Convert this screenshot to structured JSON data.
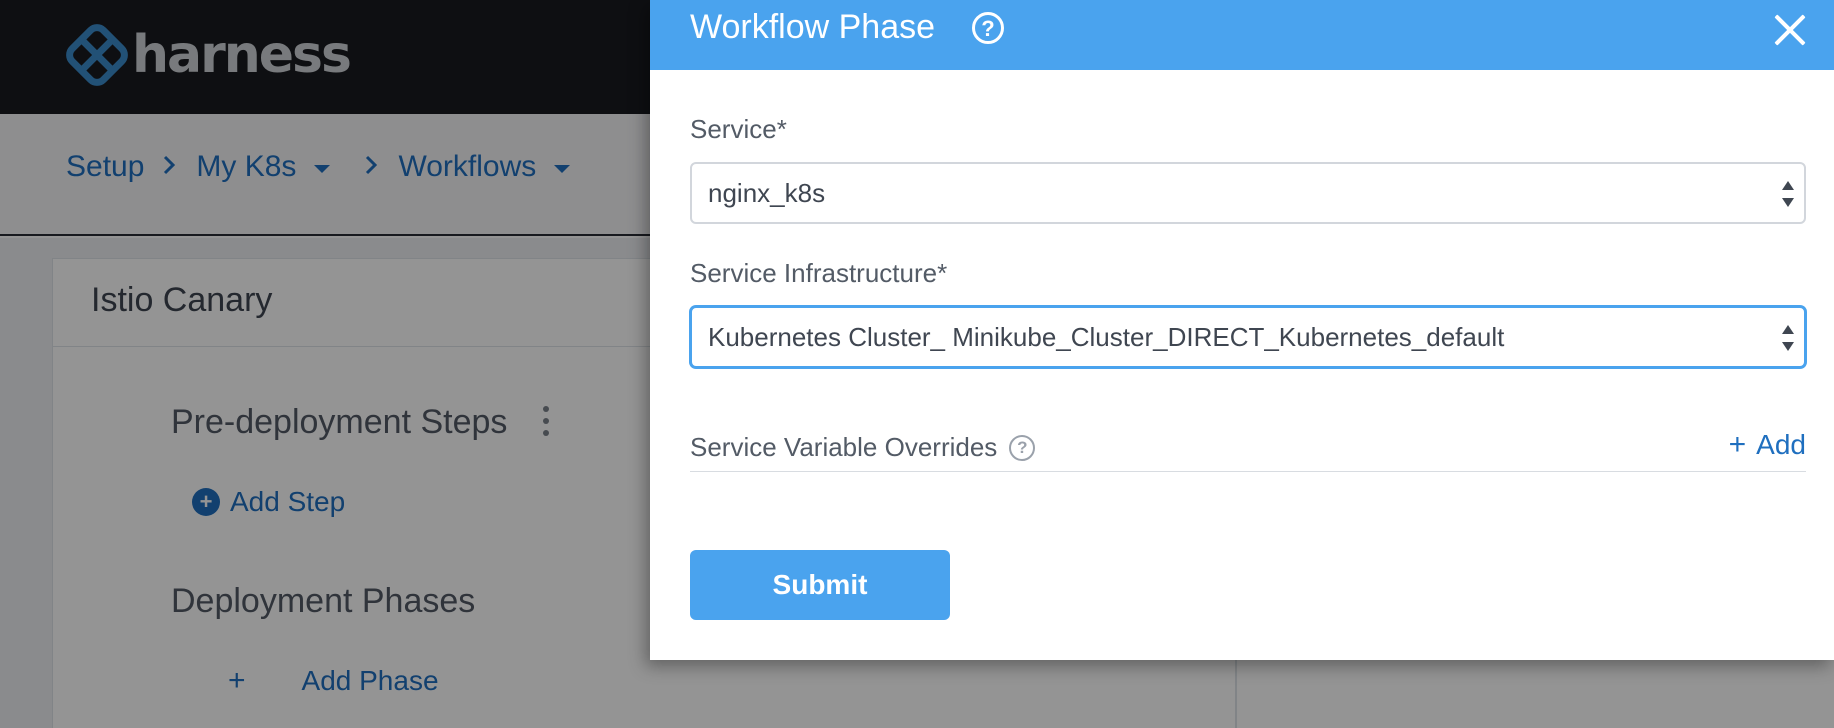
{
  "colors": {
    "topbar_bg": "#191b1f",
    "logo_blue": "#3c8ccc",
    "logo_text": "#cfd3d8",
    "link_blue": "#1f6fbf",
    "primary_blue": "#4aa3ee",
    "text_dark": "#3f4651",
    "text_label": "#535b66",
    "overlay": "rgba(0,0,0,0.42)"
  },
  "app": {
    "logo_text": "harness",
    "logo_icon": "harness-diamond-icon"
  },
  "breadcrumb": {
    "items": [
      "Setup",
      "My K8s",
      "Workflows"
    ],
    "separator_icon": "chevron-right-icon",
    "dropdown_icon": "caret-down-icon"
  },
  "workflow": {
    "title": "Istio Canary",
    "pre_deployment_heading": "Pre-deployment Steps",
    "more_icon": "kebab-menu-icon",
    "add_step_label": "Add Step",
    "add_step_icon": "plus-circle-icon",
    "deployment_phases_heading": "Deployment Phases",
    "add_phase_plus": "+",
    "add_phase_label": "Add Phase"
  },
  "modal": {
    "title": "Workflow Phase",
    "help_icon": "question-circle-icon",
    "close_icon": "close-icon",
    "service_label": "Service*",
    "service_value": "nginx_k8s",
    "infra_label": "Service Infrastructure*",
    "infra_value": "Kubernetes Cluster_ Minikube_Cluster_DIRECT_Kubernetes_default",
    "overrides_label": "Service Variable Overrides",
    "add_plus": "+",
    "add_label": "Add",
    "submit_label": "Submit"
  }
}
